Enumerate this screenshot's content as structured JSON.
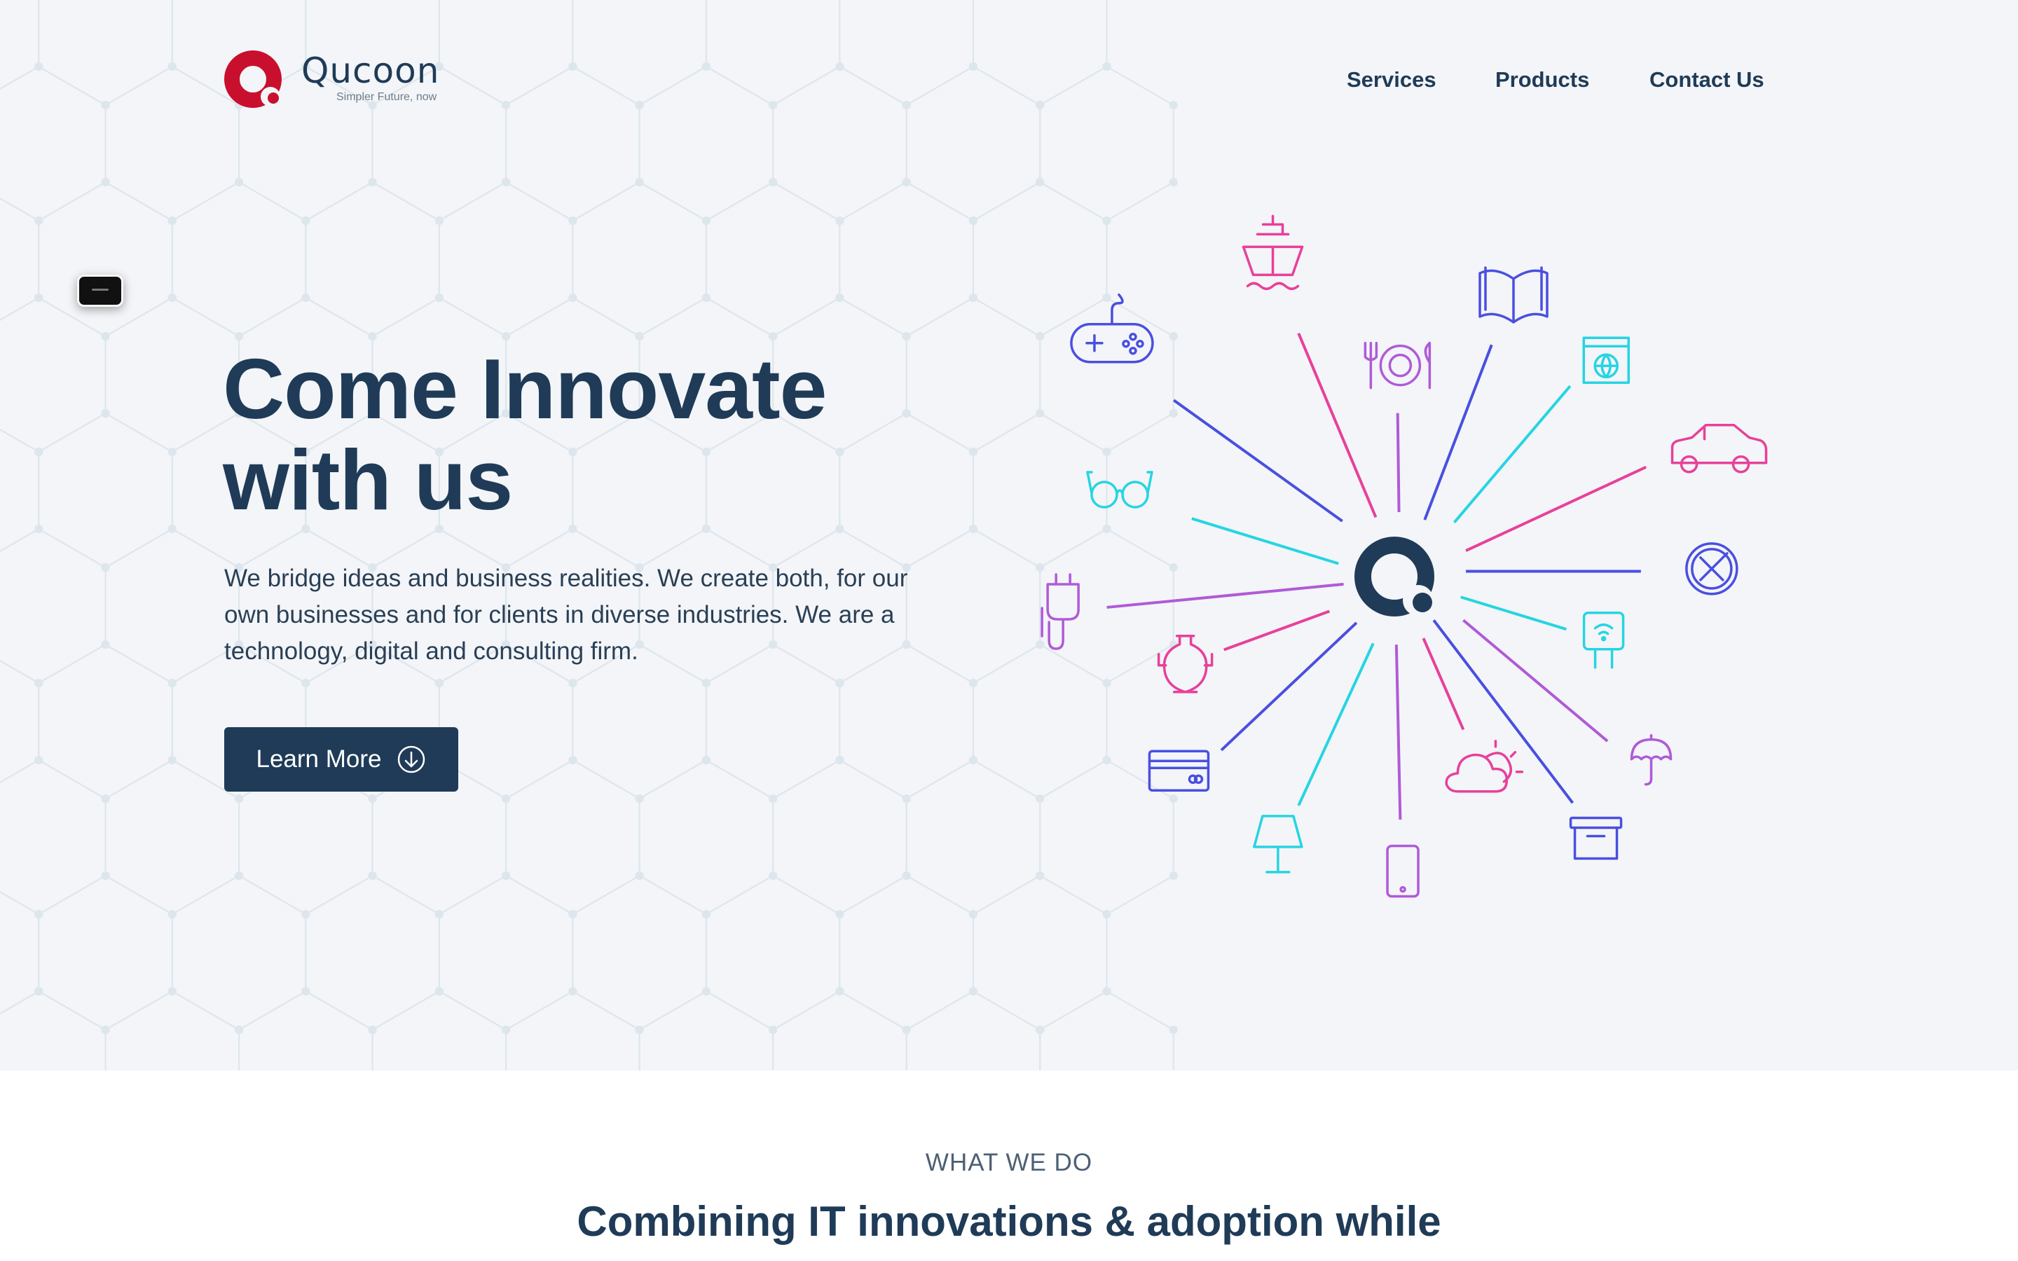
{
  "brand": {
    "name": "Qucoon",
    "tagline": "Simpler Future, now",
    "color": "#c8102e"
  },
  "nav": {
    "items": [
      "Services",
      "Products",
      "Contact Us"
    ]
  },
  "hero": {
    "title_line1": "Come Innovate",
    "title_line2": "with us",
    "description": "We bridge ideas and business realities. We create both, for our own businesses and for clients in diverse industries. We are a technology, digital and consulting firm.",
    "cta_label": "Learn More",
    "cta_icon": "arrow-down-circle-icon"
  },
  "industries_graphic": {
    "center_icon": "qucoon-q-icon",
    "colors": {
      "blue": "#4a4fe0",
      "pink": "#e8409a",
      "cyan": "#27d4e3",
      "purple": "#b05ad8",
      "dark": "#1f3b57"
    },
    "icons": [
      "ship-icon",
      "book-icon",
      "gamepad-icon",
      "dining-icon",
      "browser-globe-icon",
      "car-icon",
      "glasses-icon",
      "tools-icon",
      "plug-icon",
      "wifi-socket-icon",
      "vase-icon",
      "umbrella-icon",
      "credit-card-icon",
      "weather-icon",
      "lamp-icon",
      "archive-box-icon",
      "phone-icon"
    ]
  },
  "what_we_do": {
    "label": "WHAT WE DO",
    "title": "Combining IT innovations & adoption while"
  }
}
